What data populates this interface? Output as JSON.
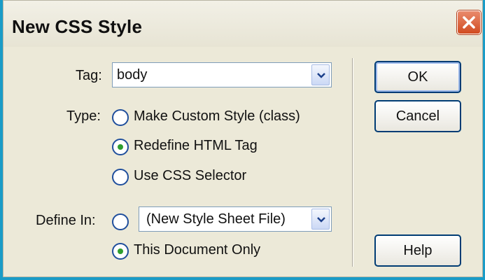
{
  "dialog": {
    "title": "New CSS Style",
    "close_icon": "close-icon"
  },
  "tag": {
    "label": "Tag:",
    "value": "body"
  },
  "type": {
    "label": "Type:",
    "options": [
      {
        "label": "Make Custom Style (class)",
        "selected": false
      },
      {
        "label": "Redefine HTML Tag",
        "selected": true
      },
      {
        "label": "Use CSS Selector",
        "selected": false
      }
    ]
  },
  "define_in": {
    "label": "Define In:",
    "file_option_selected": false,
    "file_value": "(New Style Sheet File)",
    "document_label": "This Document Only",
    "document_selected": true
  },
  "buttons": {
    "ok": "OK",
    "cancel": "Cancel",
    "help": "Help"
  },
  "colors": {
    "frame": "#1a9cc7",
    "dialog_bg": "#ece9d8",
    "button_border": "#003c74",
    "radio_dot": "#2e9e2e",
    "close": "#d14b21"
  }
}
